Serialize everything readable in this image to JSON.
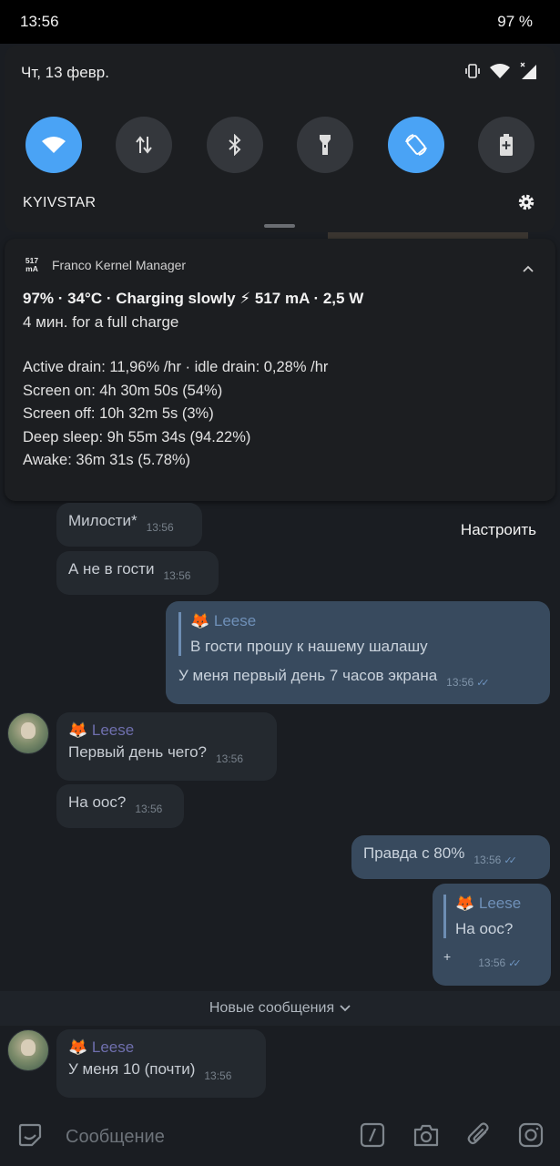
{
  "status_bar": {
    "time": "13:56",
    "battery": "97 %"
  },
  "quick_settings": {
    "date": "Чт, 13 февр.",
    "carrier": "KYIVSTAR",
    "tiles": [
      {
        "name": "wifi",
        "active": true
      },
      {
        "name": "mobile-data",
        "active": false
      },
      {
        "name": "bluetooth",
        "active": false
      },
      {
        "name": "flashlight",
        "active": false
      },
      {
        "name": "auto-rotate",
        "active": true
      },
      {
        "name": "battery-saver",
        "active": false
      }
    ],
    "accent_color": "#4aa3f5"
  },
  "notification": {
    "app_icon_line1": "517",
    "app_icon_line2": "mA",
    "app_name": "Franco Kernel Manager",
    "title": "97% · 34°C · Charging slowly ⚡ 517 mA · 2,5 W",
    "subtitle": "4 мин. for a full charge",
    "lines": [
      "Active drain: 11,96% /hr · idle drain: 0,28% /hr",
      "Screen on: 4h 30m 50s  (54%)",
      "Screen off: 10h 32m 5s  (3%)",
      "Deep sleep: 9h 55m 34s  (94.22%)",
      "Awake: 36m 31s  (5.78%)"
    ]
  },
  "chat": {
    "action_label": "Настроить",
    "messages": [
      {
        "text": "Милости*",
        "time": "13:56"
      },
      {
        "text": "А не в гости",
        "time": "13:56"
      },
      {
        "reply_name": "🦊 Leese",
        "reply_text": "В гости прошу к нашему шалашу",
        "text": "У меня первый день 7 часов экрана",
        "time": "13:56"
      },
      {
        "sender": "🦊 Leese",
        "text": "Первый день чего?",
        "time": "13:56"
      },
      {
        "text": "На оос?",
        "time": "13:56"
      },
      {
        "text": "Правда с 80%",
        "time": "13:56"
      },
      {
        "reply_name": "🦊 Leese",
        "reply_text": "На оос?",
        "text": "+",
        "time": "13:56"
      },
      {
        "sender": "🦊 Leese",
        "text": "У меня 10 (почти)",
        "time": "13:56"
      }
    ],
    "new_messages_label": "Новые сообщения",
    "input_placeholder": "Сообщение"
  }
}
